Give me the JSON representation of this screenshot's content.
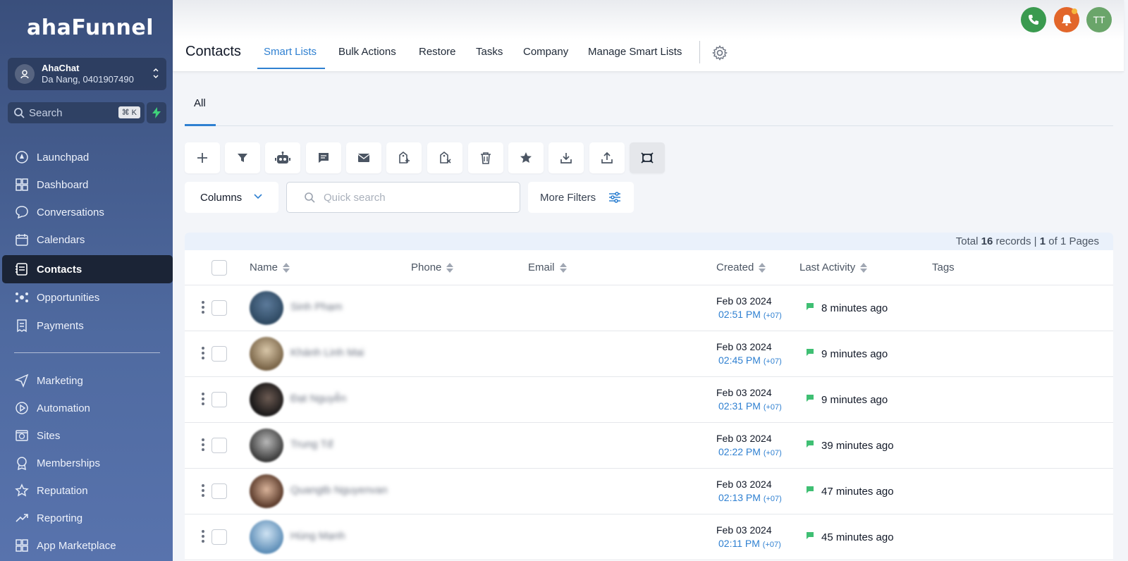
{
  "app": {
    "logo": "ahaFunnel"
  },
  "account": {
    "name": "AhaChat",
    "details": "Da Nang, 0401907490"
  },
  "search": {
    "label": "Search",
    "shortcut": "⌘ K"
  },
  "sidebar": {
    "items": [
      {
        "label": "Launchpad",
        "icon": "rocket-icon"
      },
      {
        "label": "Dashboard",
        "icon": "grid-icon"
      },
      {
        "label": "Conversations",
        "icon": "chat-icon"
      },
      {
        "label": "Calendars",
        "icon": "calendar-icon"
      },
      {
        "label": "Contacts",
        "icon": "contacts-icon",
        "active": true
      },
      {
        "label": "Opportunities",
        "icon": "network-icon"
      },
      {
        "label": "Payments",
        "icon": "receipt-icon"
      },
      {
        "label": "Marketing",
        "icon": "send-icon"
      },
      {
        "label": "Automation",
        "icon": "play-circle-icon"
      },
      {
        "label": "Sites",
        "icon": "globe-icon"
      },
      {
        "label": "Memberships",
        "icon": "badge-icon"
      },
      {
        "label": "Reputation",
        "icon": "star-icon"
      },
      {
        "label": "Reporting",
        "icon": "trend-icon"
      },
      {
        "label": "App Marketplace",
        "icon": "apps-icon"
      }
    ]
  },
  "header": {
    "title": "Contacts",
    "tabs": [
      "Smart Lists",
      "Bulk Actions",
      "Restore",
      "Tasks",
      "Company",
      "Manage Smart Lists"
    ],
    "avatar_initials": "TT"
  },
  "subtabs": {
    "all": "All"
  },
  "toolbar": {
    "columns_label": "Columns",
    "search_placeholder": "Quick search",
    "more_filters_label": "More Filters"
  },
  "table": {
    "records": {
      "prefix": "Total",
      "total": "16",
      "middle": "records |",
      "page": "1",
      "suffix": "of 1 Pages"
    },
    "columns": [
      "Name",
      "Phone",
      "Email",
      "Created",
      "Last Activity",
      "Tags"
    ],
    "rows": [
      {
        "name": "Sinh Phạm",
        "created_date": "Feb 03 2024",
        "created_time": "02:51 PM",
        "tz": "(+07)",
        "activity": "8 minutes ago"
      },
      {
        "name": "Khánh Linh Mai",
        "created_date": "Feb 03 2024",
        "created_time": "02:45 PM",
        "tz": "(+07)",
        "activity": "9 minutes ago"
      },
      {
        "name": "Đạt Nguyễn",
        "created_date": "Feb 03 2024",
        "created_time": "02:31 PM",
        "tz": "(+07)",
        "activity": "9 minutes ago"
      },
      {
        "name": "Trung Tđ",
        "created_date": "Feb 03 2024",
        "created_time": "02:22 PM",
        "tz": "(+07)",
        "activity": "39 minutes ago"
      },
      {
        "name": "Quangtb Nguyenvan",
        "created_date": "Feb 03 2024",
        "created_time": "02:13 PM",
        "tz": "(+07)",
        "activity": "47 minutes ago"
      },
      {
        "name": "Hùng Mạnh",
        "created_date": "Feb 03 2024",
        "created_time": "02:11 PM",
        "tz": "(+07)",
        "activity": "45 minutes ago"
      }
    ]
  },
  "colors": {
    "accent": "#2f80d1",
    "sidebar": "#4f6aa0",
    "phone": "#3a9a4f",
    "bell": "#e2662a",
    "avatar": "#6aa56a",
    "activity": "#3fbf73"
  }
}
